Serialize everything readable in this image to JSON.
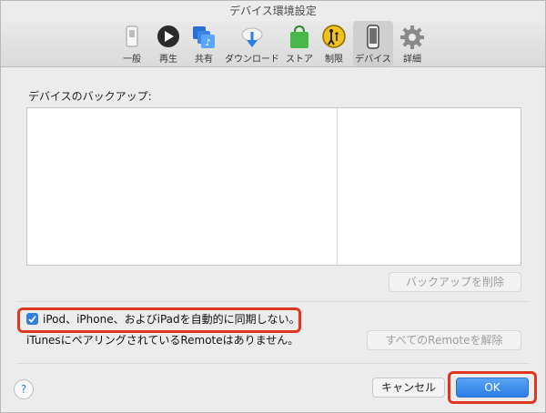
{
  "window": {
    "title": "デバイス環境設定"
  },
  "toolbar": {
    "items": [
      {
        "label": "一般",
        "icon": "general-switch-icon"
      },
      {
        "label": "再生",
        "icon": "play-icon"
      },
      {
        "label": "共有",
        "icon": "sharing-icon"
      },
      {
        "label": "ダウンロード",
        "icon": "download-cloud-icon"
      },
      {
        "label": "ストア",
        "icon": "store-bag-icon"
      },
      {
        "label": "制限",
        "icon": "parental-restrictions-icon"
      },
      {
        "label": "デバイス",
        "icon": "device-phone-icon",
        "active": true
      },
      {
        "label": "詳細",
        "icon": "gear-icon"
      }
    ]
  },
  "backup": {
    "section_label": "デバイスのバックアップ:",
    "delete_button": "バックアップを削除"
  },
  "sync": {
    "checkbox_label": "iPod、iPhone、およびiPadを自動的に同期しない。",
    "checked": true
  },
  "remote": {
    "status_text": "iTunesにペアリングされているRemoteはありません。",
    "unpair_button": "すべてのRemoteを解除"
  },
  "footer": {
    "help": "?",
    "cancel": "キャンセル",
    "ok": "OK"
  },
  "colors": {
    "accent": "#2a7ee6",
    "highlight": "#e0361f"
  }
}
